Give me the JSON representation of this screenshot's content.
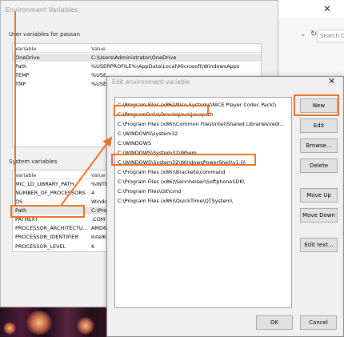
{
  "background_window": {
    "search_placeholder": "Search C"
  },
  "env_dialog": {
    "title": "Environment Variables",
    "user_section_label": "User variables for passan",
    "columns": {
      "variable": "Variable",
      "value": "Value"
    },
    "user_rows": [
      {
        "variable": "OneDrive",
        "value": "C:\\Users\\Administrator\\OneDrive"
      },
      {
        "variable": "Path",
        "value": "%USERPROFILE%\\AppData\\Local\\Microsoft\\WindowsApps"
      },
      {
        "variable": "TEMP",
        "value": "%USE"
      },
      {
        "variable": "TMP",
        "value": "%USE"
      }
    ],
    "system_section_label": "System variables",
    "system_rows": [
      {
        "variable": "MIC_LD_LIBRARY_PATH",
        "value": "%INTE"
      },
      {
        "variable": "NUMBER_OF_PROCESSORS",
        "value": "4"
      },
      {
        "variable": "OS",
        "value": "Windo"
      },
      {
        "variable": "Path",
        "value": "C:\\Pro"
      },
      {
        "variable": "PATHEXT",
        "value": ".COM"
      },
      {
        "variable": "PROCESSOR_ARCHITECTU...",
        "value": "AMD6"
      },
      {
        "variable": "PROCESSOR_IDENTIFIER",
        "value": "Intel6"
      },
      {
        "variable": "PROCESSOR_LEVEL",
        "value": "6"
      }
    ]
  },
  "edit_dialog": {
    "title": "Edit environment variable",
    "paths": [
      "C:\\Program Files (x86)\\Nice Systems\\NICE Player Codec Pack\\\\",
      "C:\\ProgramData\\Oracle\\Java\\javapath",
      "C:\\Program Files (x86)\\Common Files\\Intel\\Shared Libraries\\redi...",
      "C:\\WINDOWS\\system32",
      "C:\\WINDOWS",
      "C:\\WINDOWS\\System32\\Wbem",
      "C:\\WINDOWS\\System32\\WindowsPowerShell\\v1.0\\",
      "C:\\Program Files (x86)\\Brackets\\command",
      "C:\\Program Files (x86)\\Sennheiser\\SoftphoneSDK\\",
      "C:\\Program Files\\Git\\cmd",
      "C:\\Program Files (x86)\\QuickTime\\QTSystem\\"
    ],
    "buttons": {
      "new": "New",
      "edit": "Edit",
      "browse": "Browse...",
      "delete": "Delete",
      "move_up": "Move Up",
      "move_down": "Move Down",
      "edit_text": "Edit text...",
      "ok": "OK",
      "cancel": "Cancel"
    }
  },
  "annotation_color": "#ea7325"
}
